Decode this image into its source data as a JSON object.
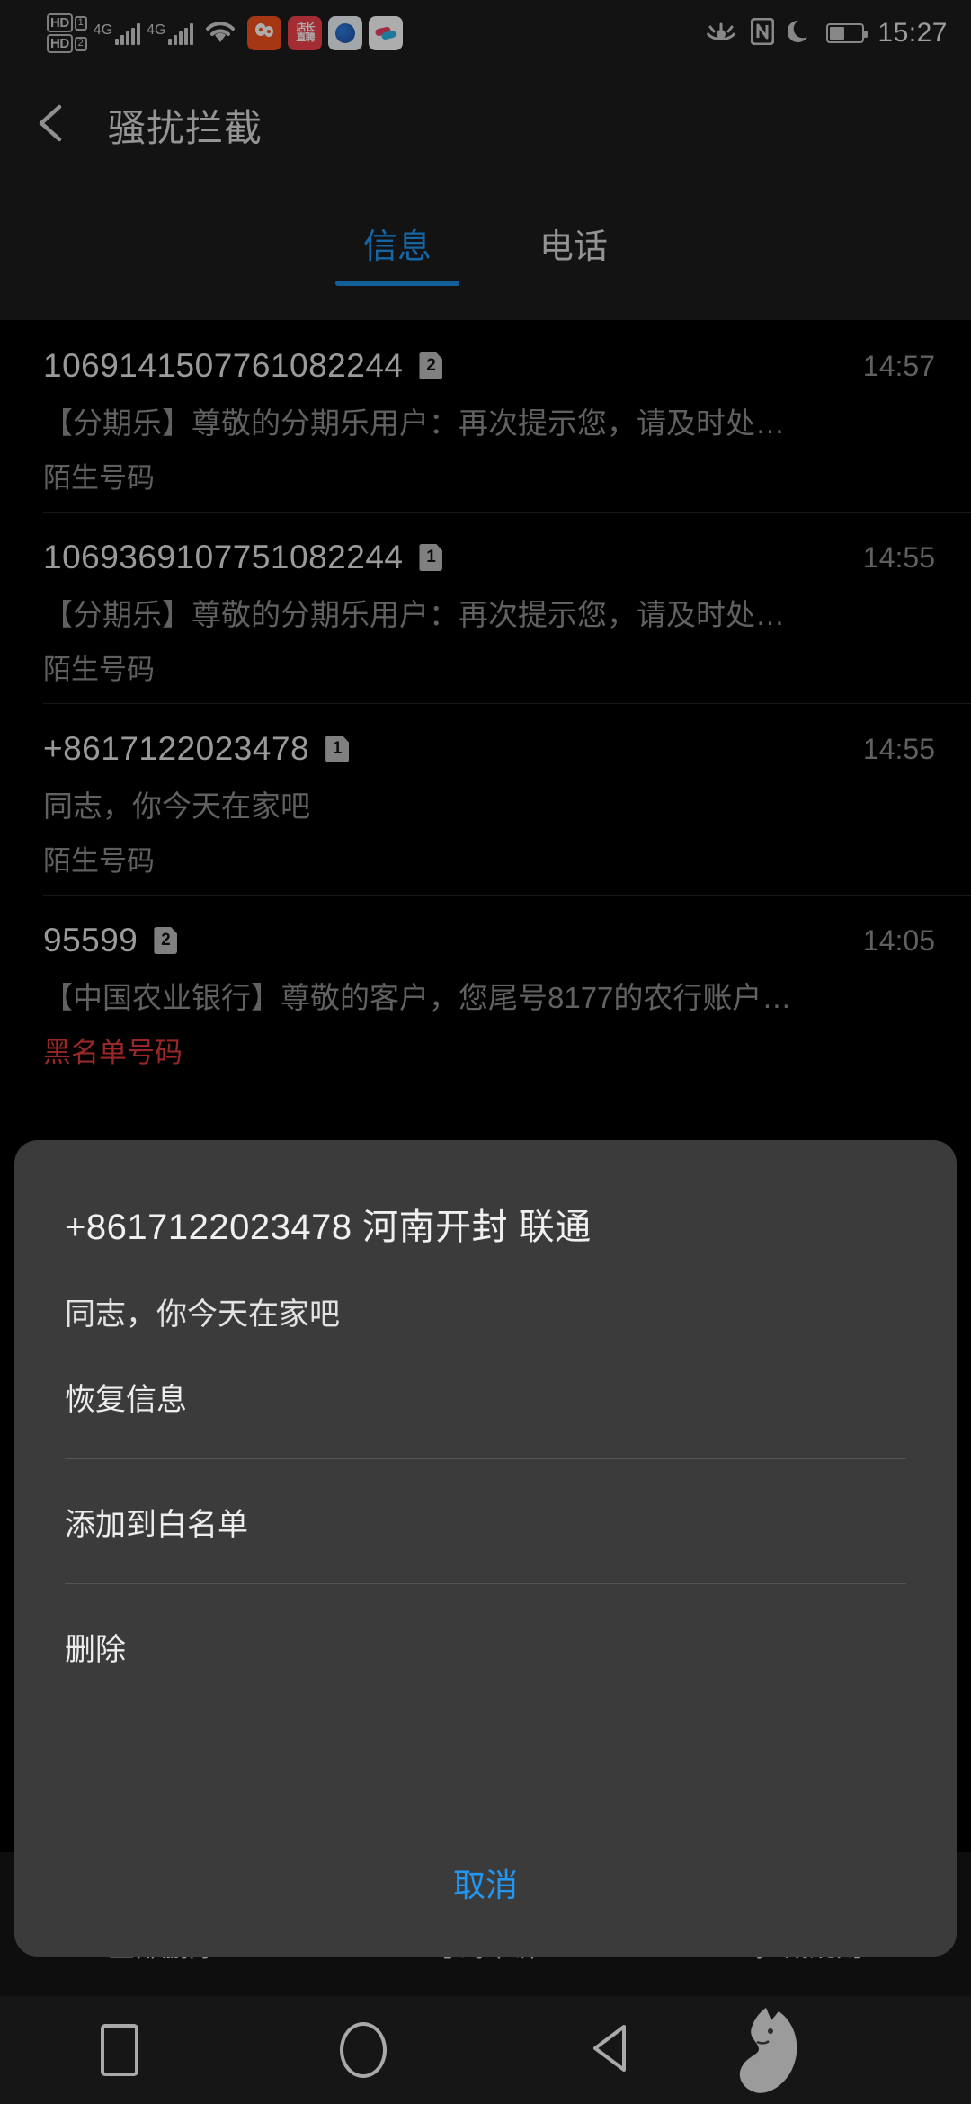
{
  "statusbar": {
    "hd1_label": "HD",
    "hd1_sim": "1",
    "hd2_label": "HD",
    "hd2_sim": "2",
    "net1": "4G",
    "net2": "4G",
    "app_icons": [
      {
        "name": "qq-notification-icon",
        "label": "QQ"
      },
      {
        "name": "boss-zhipin-notification-icon",
        "label": "店长直聘"
      },
      {
        "name": "blue-app-notification-icon",
        "label": ""
      },
      {
        "name": "youku-notification-icon",
        "label": "YOUKU"
      }
    ],
    "eye_comfort": "eye-comfort-icon",
    "nfc": "nfc-icon",
    "dnd": "do-not-disturb-moon-icon",
    "battery_level": "46",
    "time": "15:27"
  },
  "appbar": {
    "back": "back-arrow-icon",
    "title": "骚扰拦截"
  },
  "tabs": [
    {
      "label": "信息",
      "active": true
    },
    {
      "label": "电话",
      "active": false
    }
  ],
  "messages": [
    {
      "number": "1069141507761082244",
      "sim": "2",
      "time": "14:57",
      "preview": "【分期乐】尊敬的分期乐用户：再次提示您，请及时处…",
      "tag": "陌生号码",
      "blacklist": false
    },
    {
      "number": "1069369107751082244",
      "sim": "1",
      "time": "14:55",
      "preview": "【分期乐】尊敬的分期乐用户：再次提示您，请及时处…",
      "tag": "陌生号码",
      "blacklist": false
    },
    {
      "number": "+8617122023478",
      "sim": "1",
      "time": "14:55",
      "preview": "同志，你今天在家吧",
      "tag": "陌生号码",
      "blacklist": false
    },
    {
      "number": "95599",
      "sim": "2",
      "time": "14:05",
      "preview": "【中国农业银行】尊敬的客户，您尾号8177的农行账户…",
      "tag": "黑名单号码",
      "blacklist": true
    }
  ],
  "toolbar": [
    {
      "label": "全部删除",
      "icon": "delete-all-icon"
    },
    {
      "label": "号码申诉",
      "icon": "number-appeal-icon"
    },
    {
      "label": "拦截规则",
      "icon": "block-rules-icon"
    }
  ],
  "dialog": {
    "title": "+8617122023478 河南开封 联通",
    "subtitle": "同志，你今天在家吧",
    "items": [
      {
        "label": "恢复信息"
      },
      {
        "label": "添加到白名单"
      },
      {
        "label": "删除"
      }
    ],
    "cancel": "取消"
  },
  "navbar": {
    "recents": "recents-square-icon",
    "home": "home-circle-icon",
    "back": "back-triangle-icon",
    "watermark": "cat-logo-watermark"
  },
  "colors": {
    "accent": "#2196f3",
    "tab_underline": "#1b8ce3",
    "blacklist": "#e03a3a",
    "sheet_bg": "#3b3b3b",
    "bar_bg": "#1c1c1c"
  }
}
